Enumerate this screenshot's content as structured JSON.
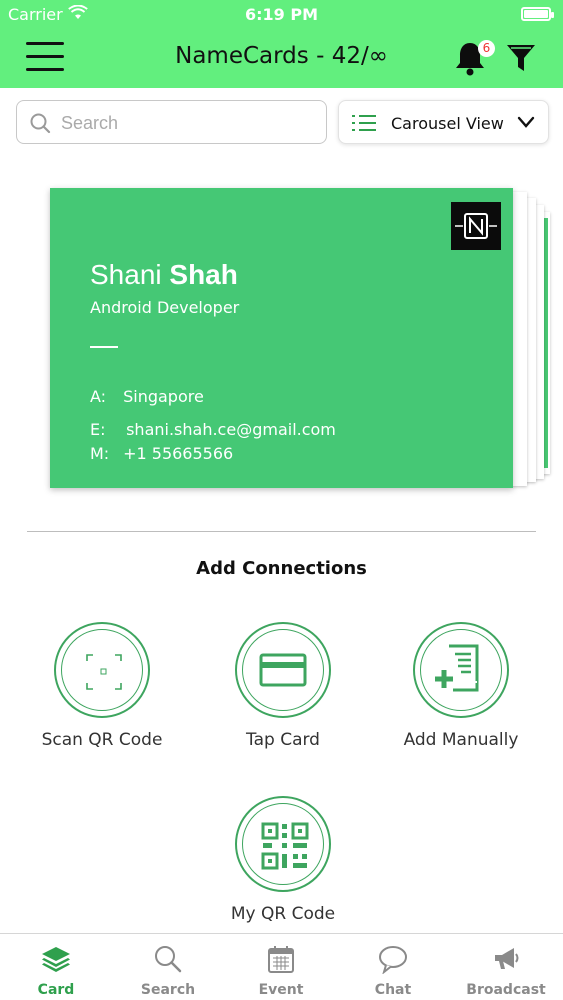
{
  "status_bar": {
    "carrier": "Carrier",
    "time": "6:19 PM"
  },
  "header": {
    "title": "NameCards - 42/∞",
    "notification_count": "6",
    "background_color": "#62ef7e"
  },
  "search": {
    "placeholder": "Search",
    "value": ""
  },
  "view_selector": {
    "selected": "Carousel View"
  },
  "card": {
    "first_name": "Shani",
    "last_name": "Shah",
    "role": "Android Developer",
    "address_key": "A:",
    "address": "Singapore",
    "email_key": "E:",
    "email": "shani.shah.ce@gmail.com",
    "mobile_key": "M:",
    "mobile": "+1 55665566",
    "color": "#45c875"
  },
  "section": {
    "title": "Add Connections"
  },
  "actions": [
    {
      "label": "Scan QR Code",
      "icon": "scan-qr-icon"
    },
    {
      "label": "Tap Card",
      "icon": "card-icon"
    },
    {
      "label": "Add Manually",
      "icon": "add-document-icon"
    },
    {
      "label": "My QR Code",
      "icon": "qr-code-icon"
    }
  ],
  "tabs": [
    {
      "label": "Card",
      "icon": "card-stack-icon",
      "active": true
    },
    {
      "label": "Search",
      "icon": "search-icon",
      "active": false
    },
    {
      "label": "Event",
      "icon": "calendar-icon",
      "active": false
    },
    {
      "label": "Chat",
      "icon": "chat-bubble-icon",
      "active": false
    },
    {
      "label": "Broadcast",
      "icon": "megaphone-icon",
      "active": false
    }
  ],
  "accent_color": "#2fa04d"
}
